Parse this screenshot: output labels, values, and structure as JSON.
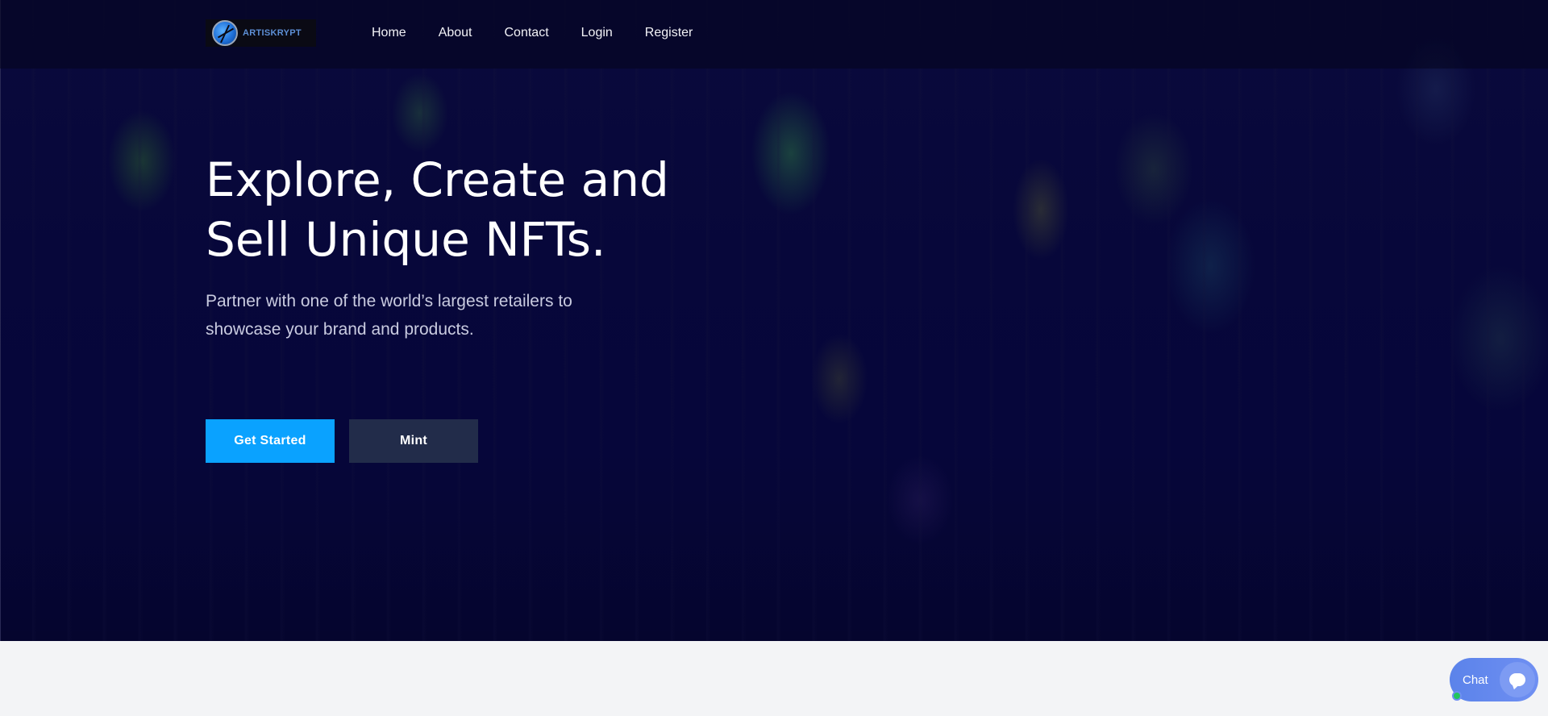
{
  "brand": {
    "name": "ARTISKRYPT",
    "icon": "globe-logo-icon"
  },
  "nav": {
    "items": [
      {
        "label": "Home"
      },
      {
        "label": "About"
      },
      {
        "label": "Contact"
      },
      {
        "label": "Login"
      },
      {
        "label": "Register"
      }
    ]
  },
  "hero": {
    "headline_line1": "Explore, Create and",
    "headline_line2": "Sell Unique NFTs.",
    "subtext_line1": "Partner with one of the world’s largest retailers to",
    "subtext_line2": "showcase your brand and products.",
    "primary_button": "Get Started",
    "secondary_button": "Mint"
  },
  "chat": {
    "label": "Chat",
    "icon": "chat-bubble-icon",
    "status": "online"
  },
  "colors": {
    "primary_button": "#0aa2ff",
    "secondary_button": "#222c4a",
    "hero_background": "#07073a",
    "chat_widget": "#6f8ff2",
    "status_online": "#22c55e",
    "page_background": "#f3f4f6"
  }
}
